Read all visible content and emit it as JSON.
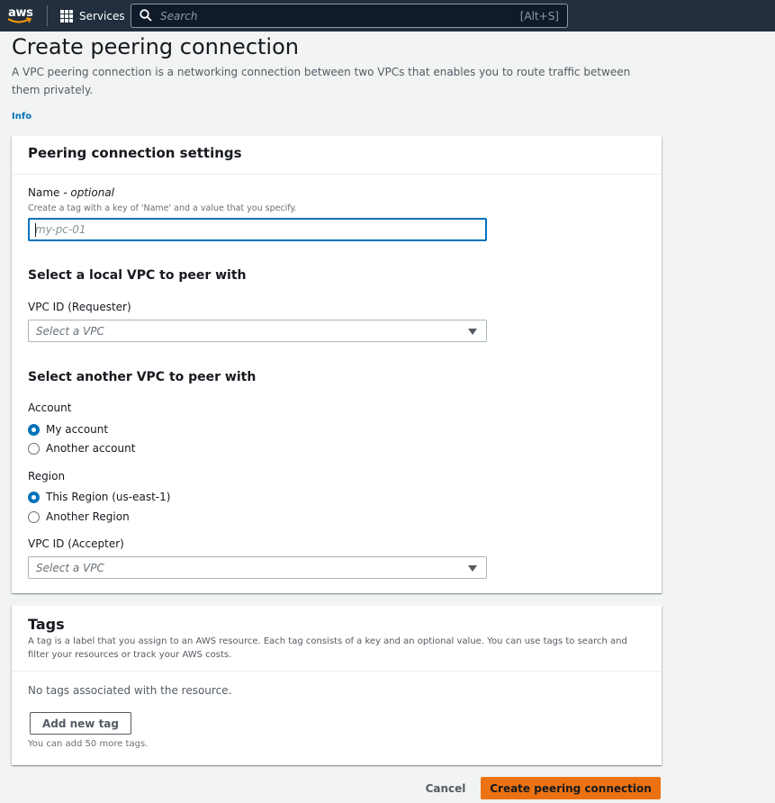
{
  "nav": {
    "logo_text": "aws",
    "services_label": "Services",
    "search_placeholder": "Search",
    "search_shortcut": "[Alt+S]"
  },
  "page": {
    "title": "Create peering connection",
    "description": "A VPC peering connection is a networking connection between two VPCs that enables you to route traffic between them privately.",
    "info_link": "Info"
  },
  "settings": {
    "title": "Peering connection settings",
    "name_label": "Name",
    "name_optional": " - optional",
    "name_hint": "Create a tag with a key of 'Name' and a value that you specify.",
    "name_placeholder": "my-pc-01",
    "local_heading": "Select a local VPC to peer with",
    "requester_label": "VPC ID (Requester)",
    "requester_value": "Select a VPC",
    "another_heading": "Select another VPC to peer with",
    "account_label": "Account",
    "account_options": [
      {
        "label": "My account",
        "selected": true
      },
      {
        "label": "Another account",
        "selected": false
      }
    ],
    "region_label": "Region",
    "region_options": [
      {
        "label": "This Region (us-east-1)",
        "selected": true
      },
      {
        "label": "Another Region",
        "selected": false
      }
    ],
    "accepter_label": "VPC ID (Accepter)",
    "accepter_value": "Select a VPC"
  },
  "tags": {
    "title": "Tags",
    "description": "A tag is a label that you assign to an AWS resource. Each tag consists of a key and an optional value. You can use tags to search and filter your resources or track your AWS costs.",
    "empty_text": "No tags associated with the resource.",
    "add_button": "Add new tag",
    "limit_hint": "You can add 50 more tags."
  },
  "actions": {
    "cancel": "Cancel",
    "create": "Create peering connection"
  },
  "colors": {
    "nav_bg": "#232f3e",
    "primary": "#ec7211",
    "link": "#0073bb",
    "page_bg": "#f2f3f3"
  }
}
